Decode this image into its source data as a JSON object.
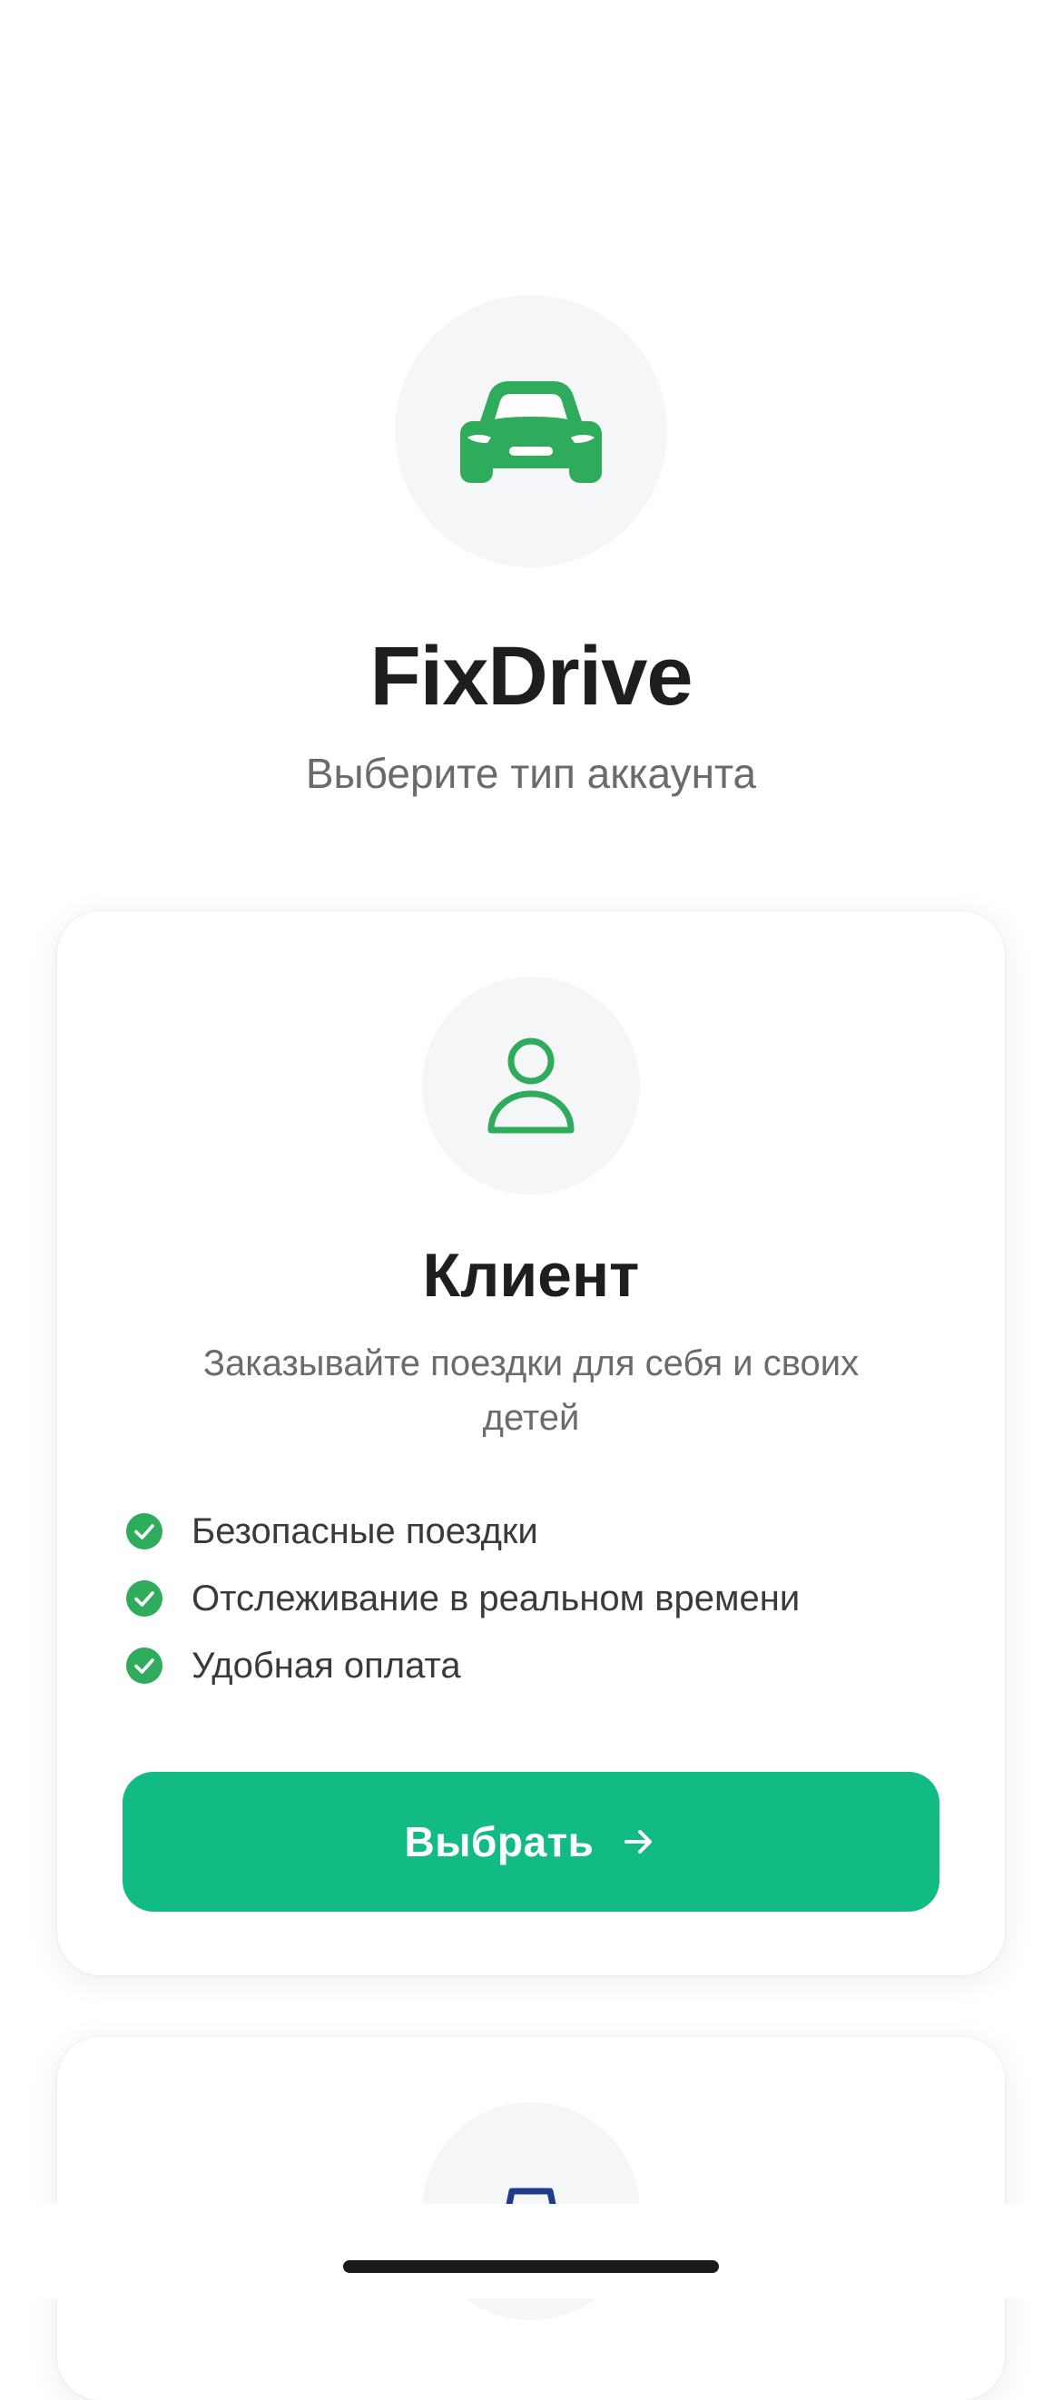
{
  "app": {
    "name": "FixDrive",
    "subtitle": "Выберите тип аккаунта",
    "logo_icon": "car-icon"
  },
  "colors": {
    "accent": "#13bb84",
    "icon_green": "#2eab5b",
    "driver_icon": "#1f3c8c",
    "icon_bg": "#f5f6f7"
  },
  "cards": [
    {
      "icon": "user-icon",
      "title": "Клиент",
      "description": "Заказывайте поездки для себя и своих детей",
      "features": [
        "Безопасные поездки",
        "Отслеживание в реальном времени",
        "Удобная оплата"
      ],
      "button_label": "Выбрать",
      "button_icon": "arrow-right-icon"
    },
    {
      "icon": "steering-wheel-icon"
    }
  ]
}
